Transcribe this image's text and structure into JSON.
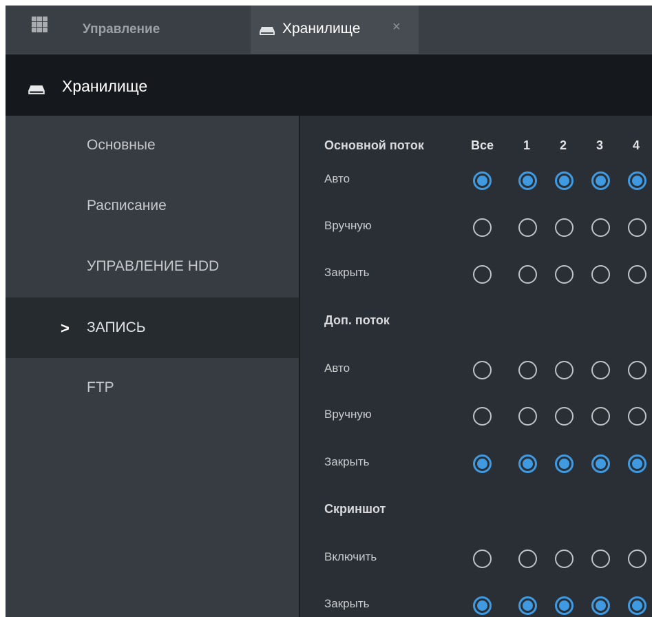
{
  "tabs": {
    "home_label": "Управление",
    "active_label": "Хранилище",
    "close_glyph": "×"
  },
  "header": {
    "title": "Хранилище"
  },
  "sidebar": {
    "items": [
      {
        "label": "Основные",
        "active": false
      },
      {
        "label": "Расписание",
        "active": false
      },
      {
        "label": "УПРАВЛЕНИЕ HDD",
        "active": false
      },
      {
        "label": "ЗАПИСЬ",
        "active": true
      },
      {
        "label": "FTP",
        "active": false
      }
    ],
    "active_marker": ">"
  },
  "record": {
    "main_stream": {
      "title": "Основной поток",
      "columns": [
        "Все",
        "1",
        "2",
        "3",
        "4"
      ],
      "rows": [
        {
          "label": "Авто",
          "checked": [
            true,
            true,
            true,
            true,
            true
          ]
        },
        {
          "label": "Вручную",
          "checked": [
            false,
            false,
            false,
            false,
            false
          ]
        },
        {
          "label": "Закрыть",
          "checked": [
            false,
            false,
            false,
            false,
            false
          ]
        }
      ]
    },
    "sub_stream": {
      "title": "Доп. поток",
      "rows": [
        {
          "label": "Авто",
          "checked": [
            false,
            false,
            false,
            false,
            false
          ]
        },
        {
          "label": "Вручную",
          "checked": [
            false,
            false,
            false,
            false,
            false
          ]
        },
        {
          "label": "Закрыть",
          "checked": [
            true,
            true,
            true,
            true,
            true
          ]
        }
      ]
    },
    "snapshot": {
      "title": "Скриншот",
      "rows": [
        {
          "label": "Включить",
          "checked": [
            false,
            false,
            false,
            false,
            false
          ]
        },
        {
          "label": "Закрыть",
          "checked": [
            true,
            true,
            true,
            true,
            true
          ]
        }
      ]
    }
  },
  "colors": {
    "accent": "#3f9ae2",
    "header_bg": "#15191d",
    "sidebar_bg": "#373c42",
    "content_bg": "#2a2f35"
  }
}
